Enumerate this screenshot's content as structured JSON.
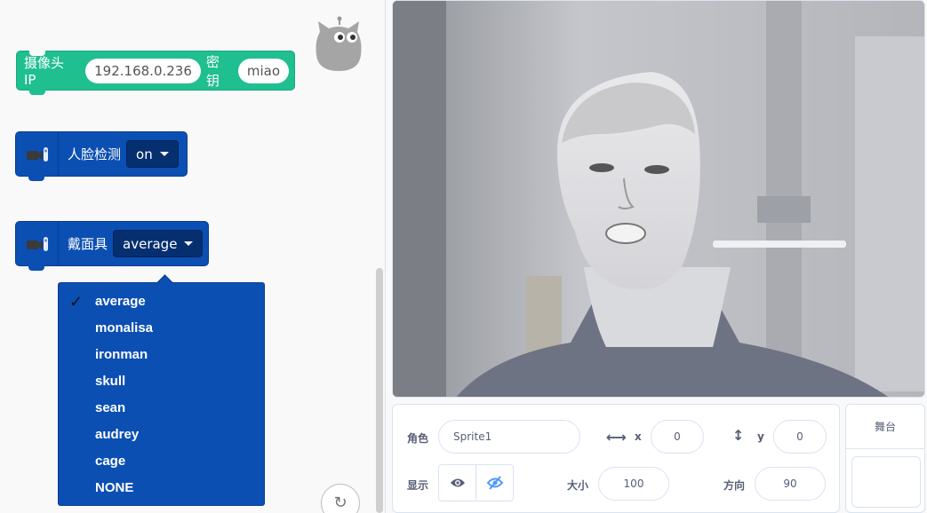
{
  "blocks": {
    "camera": {
      "label": "摄像头 IP",
      "ip_value": "192.168.0.236",
      "key_label": "密钥",
      "key_value": "miao"
    },
    "face_detect": {
      "label": "人脸检测",
      "value": "on"
    },
    "mask": {
      "label": "戴面具",
      "value": "average"
    }
  },
  "mask_menu": {
    "selected_index": 0,
    "items": [
      "average",
      "monalisa",
      "ironman",
      "skull",
      "sean",
      "audrey",
      "cage",
      "NONE"
    ]
  },
  "sprite_info": {
    "sprite_label": "角色",
    "sprite_name": "Sprite1",
    "x_label": "x",
    "x_value": "0",
    "y_label": "y",
    "y_value": "0",
    "show_label": "显示",
    "size_label": "大小",
    "size_value": "100",
    "direction_label": "方向",
    "direction_value": "90"
  },
  "stage_panel": {
    "title": "舞台"
  },
  "colors": {
    "extension_blue": "#0b4fb3",
    "camera_green": "#1fbf8f",
    "stage_bg": "#b9bcc2"
  },
  "icons": [
    "cat-mascot-icon",
    "camera-extension-icon",
    "check-icon",
    "reset-icon",
    "x-arrows-icon",
    "y-arrows-icon",
    "eye-icon",
    "eye-off-icon"
  ]
}
